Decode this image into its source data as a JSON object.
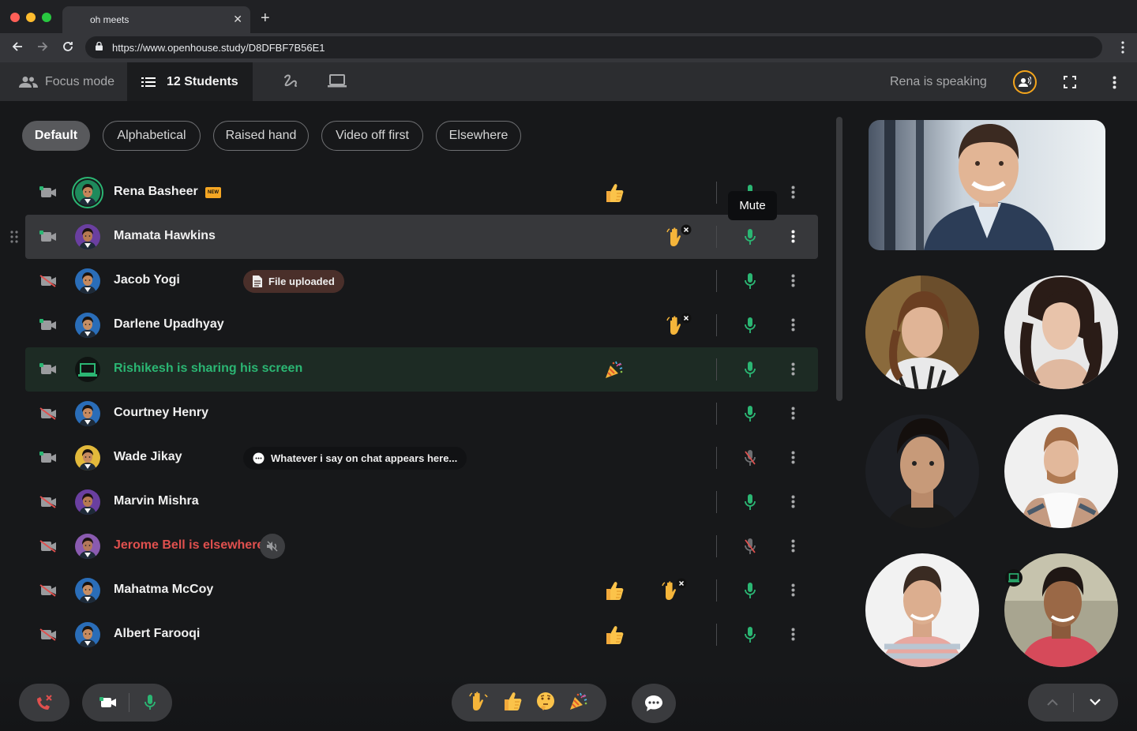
{
  "browser": {
    "tab_title": "oh meets",
    "url": "https://www.openhouse.study/D8DFBF7B56E1"
  },
  "toolbar": {
    "focus_label": "Focus mode",
    "students_label": "12 Students",
    "speaking_label": "Rena is speaking"
  },
  "filters": [
    "Default",
    "Alphabetical",
    "Raised hand",
    "Video off first",
    "Elsewhere"
  ],
  "active_filter": "Default",
  "tooltip": "Mute",
  "students": [
    {
      "name": "Rena Basheer",
      "badge": "NEW",
      "video": true,
      "mic": "on",
      "emoji": "thumbs-up"
    },
    {
      "name": "Mamata Hawkins",
      "video": true,
      "mic": "on",
      "hand": true
    },
    {
      "name": "Jacob Yogi",
      "video": false,
      "mic": "on",
      "pill": "File uploaded"
    },
    {
      "name": "Darlene Upadhyay",
      "video": true,
      "mic": "on",
      "hand": true
    },
    {
      "name": "Rishikesh is sharing his screen",
      "video": true,
      "mic": "on",
      "emoji": "party"
    },
    {
      "name": "Courtney Henry",
      "video": false,
      "mic": "on"
    },
    {
      "name": "Wade Jikay",
      "video": true,
      "mic": "off",
      "pill": "Whatever i say on chat appears here..."
    },
    {
      "name": "Marvin Mishra",
      "video": false,
      "mic": "on"
    },
    {
      "name": "Jerome Bell is elsewhere",
      "video": false,
      "mic": "off"
    },
    {
      "name": "Mahatma McCoy",
      "video": false,
      "mic": "on",
      "emoji": "thumbs-up",
      "hand": true
    },
    {
      "name": "Albert Farooqi",
      "video": false,
      "mic": "on",
      "emoji": "thumbs-up"
    }
  ],
  "colors": {
    "accent_green": "#2bb673",
    "alert_red": "#e0504e",
    "speaking_ring": "#f4a51c"
  },
  "reactions": [
    "raised-hand",
    "thumbs-up",
    "thinking",
    "party-popper"
  ]
}
